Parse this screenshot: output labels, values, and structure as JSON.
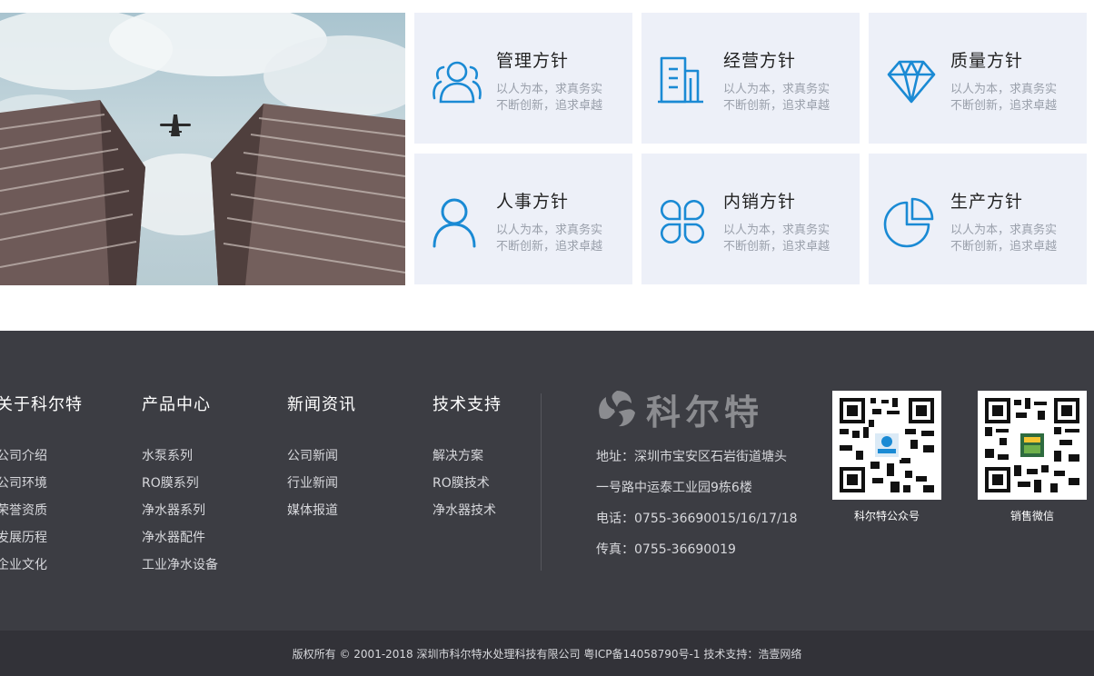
{
  "cards": [
    {
      "title": "管理方针",
      "line1": "以人为本，求真务实",
      "line2": "不断创新，追求卓越",
      "icon": "people-group-icon"
    },
    {
      "title": "经营方针",
      "line1": "以人为本，求真务实",
      "line2": "不断创新，追求卓越",
      "icon": "building-icon"
    },
    {
      "title": "质量方针",
      "line1": "以人为本，求真务实",
      "line2": "不断创新，追求卓越",
      "icon": "diamond-icon"
    },
    {
      "title": "人事方针",
      "line1": "以人为本，求真务实",
      "line2": "不断创新，追求卓越",
      "icon": "person-icon"
    },
    {
      "title": "内销方针",
      "line1": "以人为本，求真务实",
      "line2": "不断创新，追求卓越",
      "icon": "clover-icon"
    },
    {
      "title": "生产方针",
      "line1": "以人为本，求真务实",
      "line2": "不断创新，追求卓越",
      "icon": "pie-chart-icon"
    }
  ],
  "footer": {
    "columns": [
      {
        "title": "关于科尔特",
        "links": [
          "公司介绍",
          "公司环境",
          "荣誉资质",
          "发展历程",
          "企业文化"
        ]
      },
      {
        "title": "产品中心",
        "links": [
          "水泵系列",
          "RO膜系列",
          "净水器系列",
          "净水器配件",
          "工业净水设备"
        ]
      },
      {
        "title": "新闻资讯",
        "links": [
          "公司新闻",
          "行业新闻",
          "媒体报道"
        ]
      },
      {
        "title": "技术支持",
        "links": [
          "解决方案",
          "RO膜技术",
          "净水器技术"
        ]
      }
    ],
    "brand_name": "科尔特",
    "contact": {
      "address_1": "地址：深圳市宝安区石岩街道塘头",
      "address_2": "一号路中运泰工业园9栋6楼",
      "phone": "电话：0755-36690015/16/17/18",
      "fax": "传真：0755-36690019"
    },
    "qr": [
      {
        "caption": "科尔特公众号"
      },
      {
        "caption": "销售微信"
      }
    ],
    "copyright": "版权所有 © 2001-2018 深圳市科尔特水处理科技有限公司 粤ICP备14058790号-1 技术支持：浩壹网络"
  },
  "colors": {
    "accent_blue": "#1a8ad4",
    "card_bg": "#edf0f8",
    "footer_bg": "#3c3d43",
    "bottom_bar_bg": "#323238"
  }
}
